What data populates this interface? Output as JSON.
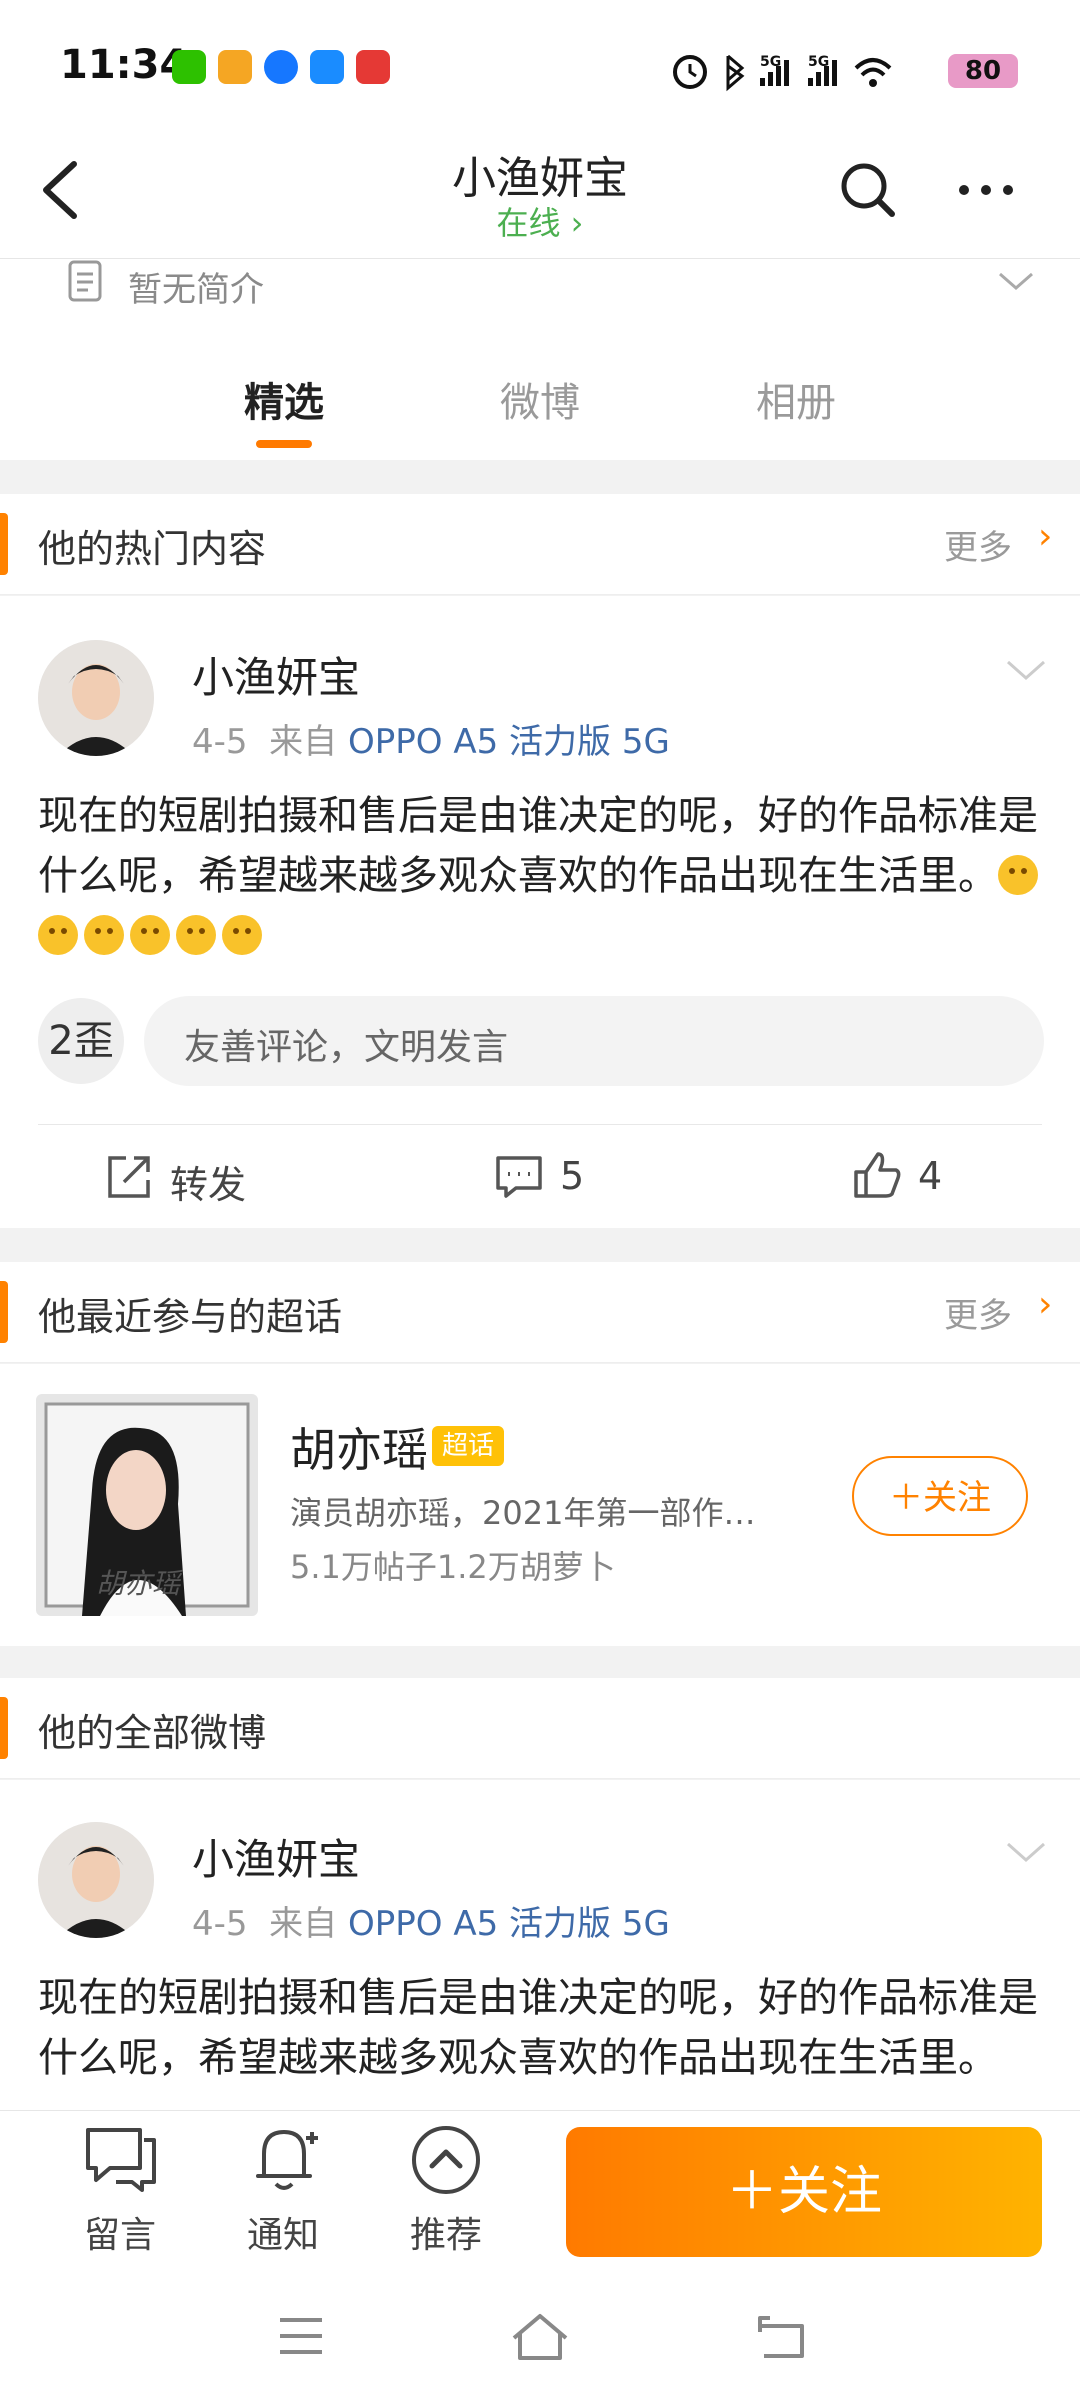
{
  "status_bar": {
    "time": "11:34",
    "battery": "80",
    "network_labels": [
      "5G",
      "5G"
    ]
  },
  "nav": {
    "title": "小渔妍宝",
    "status": "在线 ›"
  },
  "profile": {
    "bio": "暂无简介"
  },
  "tabs": [
    {
      "label": "精选",
      "active": true
    },
    {
      "label": "微博",
      "active": false
    },
    {
      "label": "相册",
      "active": false
    }
  ],
  "hot": {
    "title": "他的热门内容",
    "more": "更多",
    "post": {
      "author": "小渔妍宝",
      "date": "4-5",
      "source_prefix": "来自",
      "source": "OPPO A5 活力版 5G",
      "text": "现在的短剧拍摄和售后是由谁决定的呢，好的作品标准是什么呢，希望越来越多观众喜欢的作品出现在生活里。",
      "emoji_count": 6,
      "comment_placeholder": "友善评论，文明发言",
      "commenter_avatar_text": "2歪",
      "actions": {
        "repost": "转发",
        "comments": "5",
        "likes": "4"
      }
    }
  },
  "super_topic": {
    "title": "他最近参与的超话",
    "more": "更多",
    "name": "胡亦瑶",
    "badge": "超话",
    "description": "演员胡亦瑶，2021年第一部作…",
    "stats": "5.1万帖子1.2万胡萝卜",
    "cover_text": "胡亦瑶",
    "follow": "＋关注"
  },
  "all_posts": {
    "title": "他的全部微博",
    "post": {
      "author": "小渔妍宝",
      "date": "4-5",
      "source_prefix": "来自",
      "source": "OPPO A5 活力版 5G",
      "text": "现在的短剧拍摄和售后是由谁决定的呢，好的作品标准是什么呢，希望越来越多观众喜欢的作品出现在生活里。"
    }
  },
  "bottom_bar": {
    "message": "留言",
    "notify": "通知",
    "recommend": "推荐",
    "follow": "＋关注"
  },
  "colors": {
    "accent": "#ff8200",
    "online": "#4caf50",
    "link": "#3e6aa8"
  }
}
